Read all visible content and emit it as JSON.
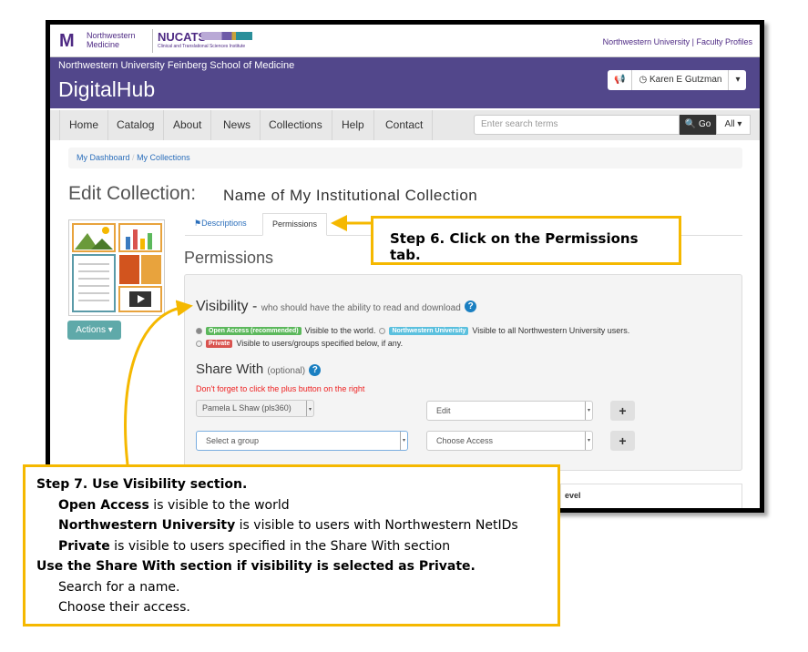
{
  "header": {
    "logo_nm": "Northwestern Medicine",
    "logo_nucats": "NUCATS",
    "nucats_sub": "Clinical and Translational Sciences Institute",
    "top_links": "Northwestern University | Faculty Profiles",
    "school": "Northwestern University Feinberg School of Medicine",
    "app": "DigitalHub",
    "user": "Karen E Gutzman"
  },
  "nav": {
    "items": [
      "Home",
      "Catalog",
      "About",
      "News",
      "Collections",
      "Help",
      "Contact"
    ],
    "search_placeholder": "Enter search terms",
    "go": "Go",
    "scope": "All"
  },
  "breadcrumb": [
    "My Dashboard",
    "My Collections"
  ],
  "page": {
    "title": "Edit Collection:",
    "collection_name": "Name of My Institutional Collection",
    "actions": "Actions",
    "tabs": [
      "Descriptions",
      "Permissions"
    ],
    "section": "Permissions"
  },
  "visibility": {
    "heading": "Visibility -",
    "sub": "who should have the ability to read and download",
    "open_label": "Open Access (recommended)",
    "open_desc": "Visible to the world.",
    "nu_label": "Northwestern University",
    "nu_desc": "Visible to all Northwestern University users.",
    "private_label": "Private",
    "private_desc": "Visible to users/groups specified below, if any."
  },
  "share": {
    "heading": "Share With",
    "optional": "(optional)",
    "warning": "Don't forget to click the plus button on the right",
    "user": "Pamela L Shaw (pls360)",
    "user_access": "Edit",
    "group_placeholder": "Select a group",
    "group_access": "Choose Access",
    "plus": "+",
    "table_header_fragment": "evel"
  },
  "colors": {
    "purple": "#52478b",
    "callout": "#f5b800",
    "open": "#5cb85c",
    "nu": "#5bc0de",
    "private": "#d9534f"
  },
  "callouts": {
    "step6": "Step 6. Click on the Permissions tab.",
    "step7": {
      "title": "Step 7. Use Visibility section.",
      "l1b": "Open Access",
      "l1": " is visible to the world",
      "l2b": "Northwestern University",
      "l2": " is visible to users with Northwestern NetIDs",
      "l3b": "Private",
      "l3": " is visible to users specified in the Share With section",
      "title2": "Use the Share With section if visibility is selected as Private.",
      "l4": "Search for a name.",
      "l5": "Choose their access."
    }
  }
}
